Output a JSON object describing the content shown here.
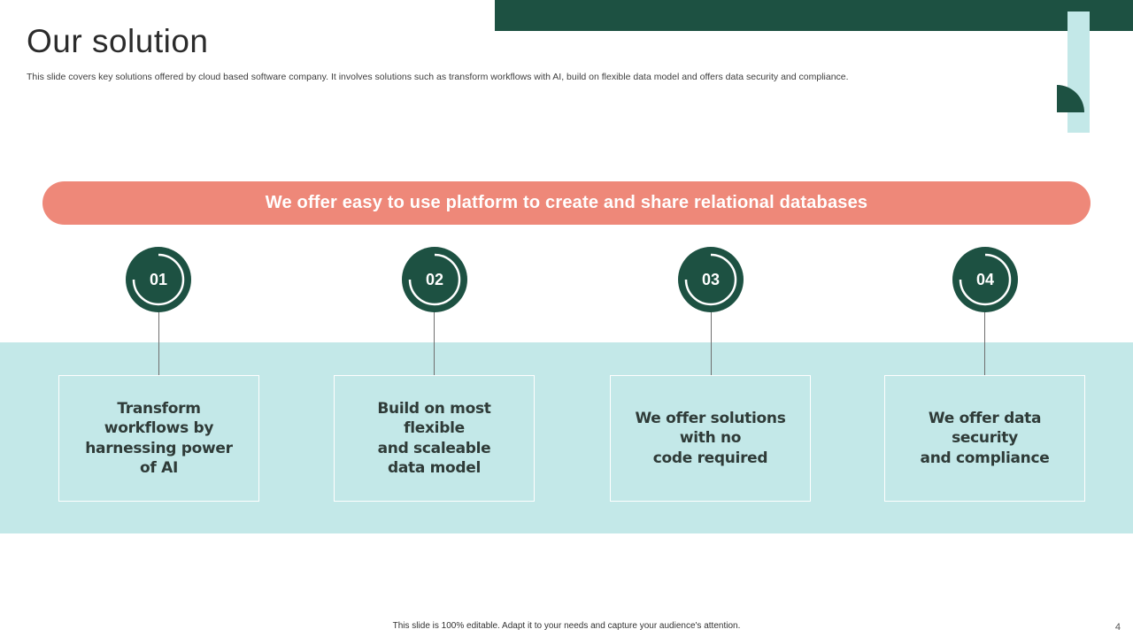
{
  "colors": {
    "dark_green": "#1d5142",
    "mint": "#c3e8e8",
    "coral": "#ee8879",
    "white": "#ffffff"
  },
  "slide": {
    "title": "Our solution",
    "subtitle": "This slide covers key solutions offered by cloud based software company. It involves solutions such as transform workflows with AI,  build on flexible data model and offers data security and compliance.",
    "banner": "We offer easy to use platform to create and share relational databases",
    "steps": [
      {
        "number": "01",
        "text": "Transform\nworkflows by\nharnessing power\nof AI"
      },
      {
        "number": "02",
        "text": "Build on most flexible\nand scaleable\ndata model"
      },
      {
        "number": "03",
        "text": "We offer solutions\nwith no\ncode required"
      },
      {
        "number": "04",
        "text": "We offer data\nsecurity\nand compliance"
      }
    ],
    "footer_note": "This slide is 100% editable.  Adapt it to your needs and capture your audience's attention.",
    "page_number": "4"
  }
}
